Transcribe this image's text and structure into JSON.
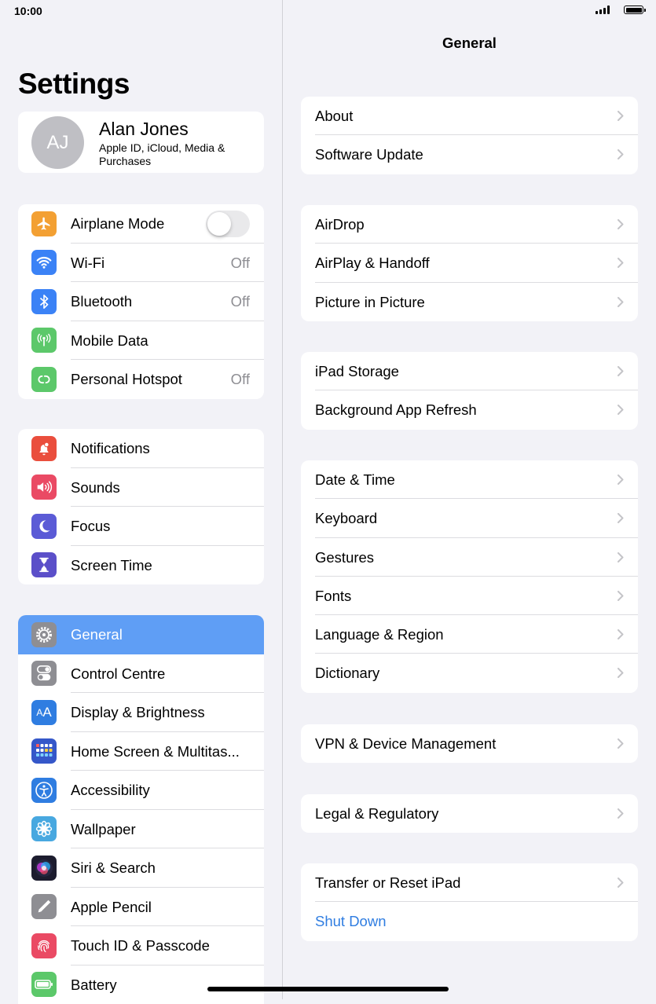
{
  "status": {
    "time": "10:00"
  },
  "sidebar": {
    "title": "Settings",
    "profile": {
      "initials": "AJ",
      "name": "Alan Jones",
      "subtitle": "Apple ID, iCloud, Media & Purchases"
    },
    "group1": [
      {
        "label": "Airplane Mode",
        "value": "",
        "icon": "airplane-icon",
        "color": "#f3a033",
        "toggle": true
      },
      {
        "label": "Wi-Fi",
        "value": "Off",
        "icon": "wifi-icon",
        "color": "#3b82f6"
      },
      {
        "label": "Bluetooth",
        "value": "Off",
        "icon": "bluetooth-icon",
        "color": "#3b82f6"
      },
      {
        "label": "Mobile Data",
        "value": "",
        "icon": "antenna-icon",
        "color": "#5cc86a"
      },
      {
        "label": "Personal Hotspot",
        "value": "Off",
        "icon": "hotspot-icon",
        "color": "#5cc86a"
      }
    ],
    "group2": [
      {
        "label": "Notifications",
        "icon": "bell-icon",
        "color": "#ea4e3d"
      },
      {
        "label": "Sounds",
        "icon": "speaker-icon",
        "color": "#ea4a64"
      },
      {
        "label": "Focus",
        "icon": "moon-icon",
        "color": "#5b5bd6"
      },
      {
        "label": "Screen Time",
        "icon": "hourglass-icon",
        "color": "#5b4fc9"
      }
    ],
    "group3": [
      {
        "label": "General",
        "icon": "gear-icon",
        "color": "#8e8e93",
        "selected": true
      },
      {
        "label": "Control Centre",
        "icon": "toggles-icon",
        "color": "#8e8e93"
      },
      {
        "label": "Display & Brightness",
        "icon": "text-size-icon",
        "color": "#2f7de1"
      },
      {
        "label": "Home Screen & Multitas...",
        "icon": "grid-icon",
        "color": "#3557c9"
      },
      {
        "label": "Accessibility",
        "icon": "accessibility-icon",
        "color": "#2f7de1"
      },
      {
        "label": "Wallpaper",
        "icon": "flower-icon",
        "color": "#48a8e0"
      },
      {
        "label": "Siri & Search",
        "icon": "siri-icon",
        "color": "#1c1c2e"
      },
      {
        "label": "Apple Pencil",
        "icon": "pencil-icon",
        "color": "#8e8e93"
      },
      {
        "label": "Touch ID & Passcode",
        "icon": "fingerprint-icon",
        "color": "#ea4a64"
      },
      {
        "label": "Battery",
        "icon": "battery-icon",
        "color": "#5cc86a"
      }
    ]
  },
  "detail": {
    "title": "General",
    "groups": [
      [
        "About",
        "Software Update"
      ],
      [
        "AirDrop",
        "AirPlay & Handoff",
        "Picture in Picture"
      ],
      [
        "iPad Storage",
        "Background App Refresh"
      ],
      [
        "Date & Time",
        "Keyboard",
        "Gestures",
        "Fonts",
        "Language & Region",
        "Dictionary"
      ],
      [
        "VPN & Device Management"
      ],
      [
        "Legal & Regulatory"
      ],
      [
        "Transfer or Reset iPad"
      ]
    ],
    "shut_down": "Shut Down"
  }
}
